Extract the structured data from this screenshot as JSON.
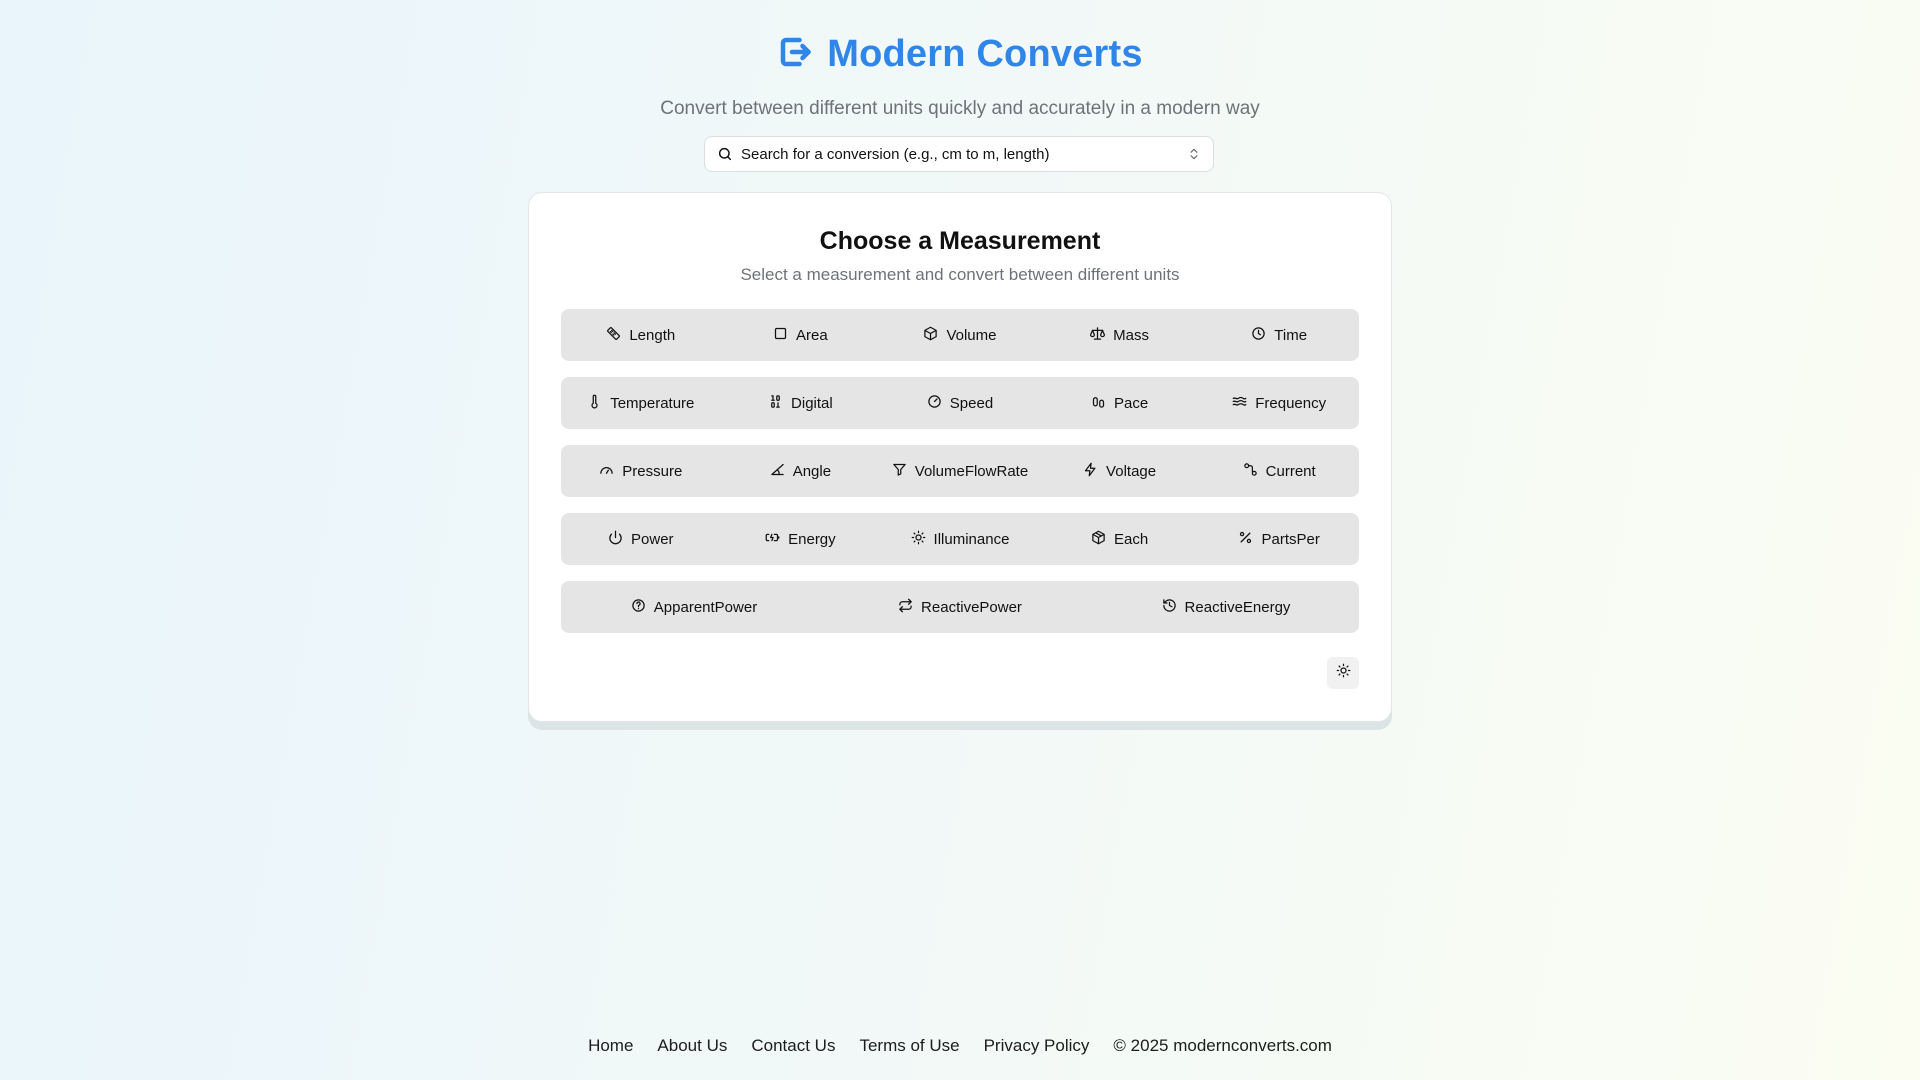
{
  "header": {
    "title": "Modern Converts",
    "subtitle": "Convert between different units quickly and accurately in a modern way",
    "brand_color": "#2f86e8",
    "logo_icon": "arrow-right-from-square-icon"
  },
  "search": {
    "placeholder": "Search for a conversion (e.g., cm to m, length)",
    "icon": "search-icon",
    "trailing_icon": "chevrons-up-down-icon"
  },
  "card": {
    "title": "Choose a Measurement",
    "subtitle": "Select a measurement and convert between different units"
  },
  "measurements": {
    "rows": [
      [
        {
          "label": "Length",
          "icon": "ruler-icon"
        },
        {
          "label": "Area",
          "icon": "square-icon"
        },
        {
          "label": "Volume",
          "icon": "box-icon"
        },
        {
          "label": "Mass",
          "icon": "scale-icon"
        },
        {
          "label": "Time",
          "icon": "clock-icon"
        }
      ],
      [
        {
          "label": "Temperature",
          "icon": "thermometer-icon"
        },
        {
          "label": "Digital",
          "icon": "binary-icon"
        },
        {
          "label": "Speed",
          "icon": "gauge-icon"
        },
        {
          "label": "Pace",
          "icon": "footprints-icon"
        },
        {
          "label": "Frequency",
          "icon": "waves-icon"
        }
      ],
      [
        {
          "label": "Pressure",
          "icon": "dial-icon"
        },
        {
          "label": "Angle",
          "icon": "angle-icon"
        },
        {
          "label": "VolumeFlowRate",
          "icon": "filter-icon"
        },
        {
          "label": "Voltage",
          "icon": "zap-icon"
        },
        {
          "label": "Current",
          "icon": "circuit-icon"
        }
      ],
      [
        {
          "label": "Power",
          "icon": "power-icon"
        },
        {
          "label": "Energy",
          "icon": "battery-icon"
        },
        {
          "label": "Illuminance",
          "icon": "sun-icon"
        },
        {
          "label": "Each",
          "icon": "package-icon"
        },
        {
          "label": "PartsPer",
          "icon": "percent-icon"
        }
      ],
      [
        {
          "label": "ApparentPower",
          "icon": "help-circle-icon"
        },
        {
          "label": "ReactivePower",
          "icon": "repeat-icon"
        },
        {
          "label": "ReactiveEnergy",
          "icon": "history-icon"
        }
      ]
    ]
  },
  "theme_toggle": {
    "icon": "sun-icon"
  },
  "footer": {
    "links": [
      "Home",
      "About Us",
      "Contact Us",
      "Terms of Use",
      "Privacy Policy"
    ],
    "copyright": "© 2025 modernconverts.com"
  }
}
